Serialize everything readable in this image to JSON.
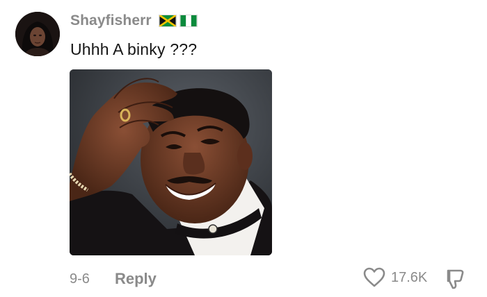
{
  "comment": {
    "username": "Shayfisherr",
    "flags": [
      "jamaica-flag",
      "nigeria-flag"
    ],
    "text": "Uhhh A binky ???",
    "attachment": "photo-of-smiling-man-hand-on-forehead",
    "date": "9-6",
    "reply_label": "Reply",
    "like_count": "17.6K",
    "icons": {
      "like": "heart-outline-icon",
      "dislike": "thumbs-down-icon"
    },
    "colors": {
      "secondary_text": "#8a8a8a",
      "primary_text": "#161616",
      "background": "#ffffff"
    }
  }
}
